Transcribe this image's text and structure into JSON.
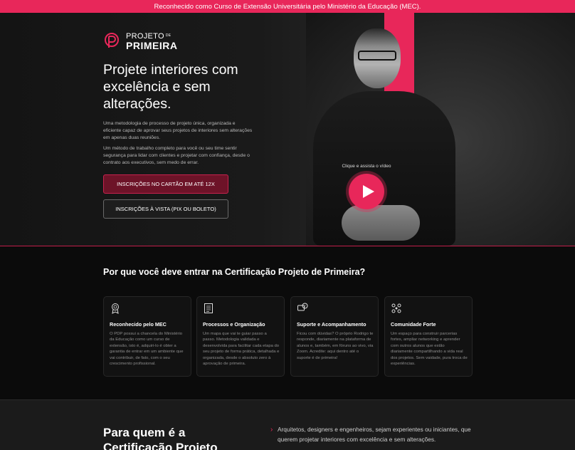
{
  "topbar": {
    "text": "Reconhecido como Curso de Extensão Universitária pelo Ministério da Educação (MEC)."
  },
  "logo": {
    "line1": "PROJETO",
    "line1_small": "DE",
    "line2": "PRIMEIRA"
  },
  "hero": {
    "title": "Projete interiores com excelência e sem alterações.",
    "paragraph1": "Uma metodologia de processo de projeto única, organizada e eficiente capaz de aprovar seus projetos de interiores sem alterações em apenas duas reuniões.",
    "paragraph2": "Um método de trabalho completo para você ou seu time sentir segurança para lidar com clientes e projetar com confiança, desde o contrato aos executivos, sem medo de errar.",
    "primary_button": "INSCRIÇÕES NO CARTÃO EM ATÉ 12X",
    "secondary_button": "INSCRIÇÕES À VISTA (PIX OU BOLETO)",
    "video_caption": "Clique e assista o vídeo"
  },
  "why": {
    "title": "Por que você deve entrar na Certificação Projeto de Primeira?",
    "cards": [
      {
        "icon": "certificate-icon",
        "title": "Reconhecido pelo MEC",
        "text": "O PDP possui a chancela do Ministério da Educação como um curso de extensão, isto é, adquiri-lo é obter a garantia de entrar em um ambiente que vai contribuir, de fato, com o seu crescimento profissional."
      },
      {
        "icon": "document-icon",
        "title": "Processos e Organização",
        "text": "Um mapa que vai te guiar passo a passo. Metodologia validada e desenvolvida para facilitar cada etapa do seu projeto de forma prática, detalhada e organizada, desde o absoluto zero à aprovação de primeira."
      },
      {
        "icon": "chat-question-icon",
        "title": "Suporte e Acompanhamento",
        "text": "Ficou com dúvidas? O próprio Rodrigo te responde, diariamente na plataforma de alunos e, também, em fóruns ao vivo, via Zoom. Acredite: aqui dentro até o suporte é de primeira!"
      },
      {
        "icon": "community-icon",
        "title": "Comunidade Forte",
        "text": "Um espaço para construir parcerias fortes, ampliar networking e aprender com outros alunos que estão diariamente compartilhando a vida real dos projetos. Sem vaidade, pura troca de experiências."
      }
    ]
  },
  "who": {
    "title": "Para quem é a Certificação Projeto",
    "item1": "Arquitetos, designers e engenheiros, sejam experientes ou iniciantes, que querem projetar interiores com excelência e sem alterações."
  },
  "colors": {
    "accent": "#e8275a",
    "dark": "#111111"
  }
}
